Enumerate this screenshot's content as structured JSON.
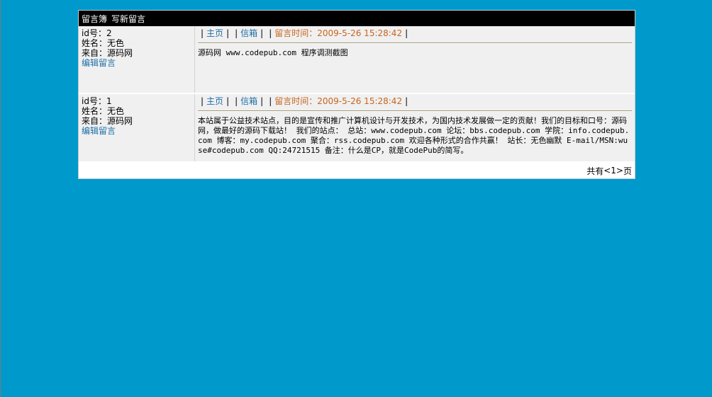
{
  "header": {
    "board_title": "留言簿",
    "new_post": "写新留言"
  },
  "entries": [
    {
      "id_label": "id号：2",
      "name_label": "姓名：无色",
      "from_label": "来自：源码网",
      "edit_label": "编辑留言",
      "home_label": "主页",
      "email_label": "信箱",
      "time_label": "留言时间：2009-5-26 15:28:42",
      "content": "源码网 www.codepub.com 程序调测截图"
    },
    {
      "id_label": "id号：1",
      "name_label": "姓名：无色",
      "from_label": "来自：源码网",
      "edit_label": "编辑留言",
      "home_label": "主页",
      "email_label": "信箱",
      "time_label": "留言时间：2009-5-26 15:28:42",
      "content": "本站属于公益技术站点，目的是宣传和推广计算机设计与开发技术，为国内技术发展做一定的贡献！我们的目标和口号：源码网，做最好的源码下载站！ 我们的站点： 总站：www.codepub.com 论坛：bbs.codepub.com 学院：info.codepub.com 博客：my.codepub.com 聚合：rss.codepub.com 欢迎各种形式的合作共赢！ 站长：无色幽默 E-mail/MSN:wuse#codepub.com QQ:24721515 备注：什么是CP，就是CodePub的简写。"
    }
  ],
  "pagination": {
    "prefix": "共有",
    "open": "<",
    "page": "1",
    "close": ">",
    "suffix": "页"
  }
}
